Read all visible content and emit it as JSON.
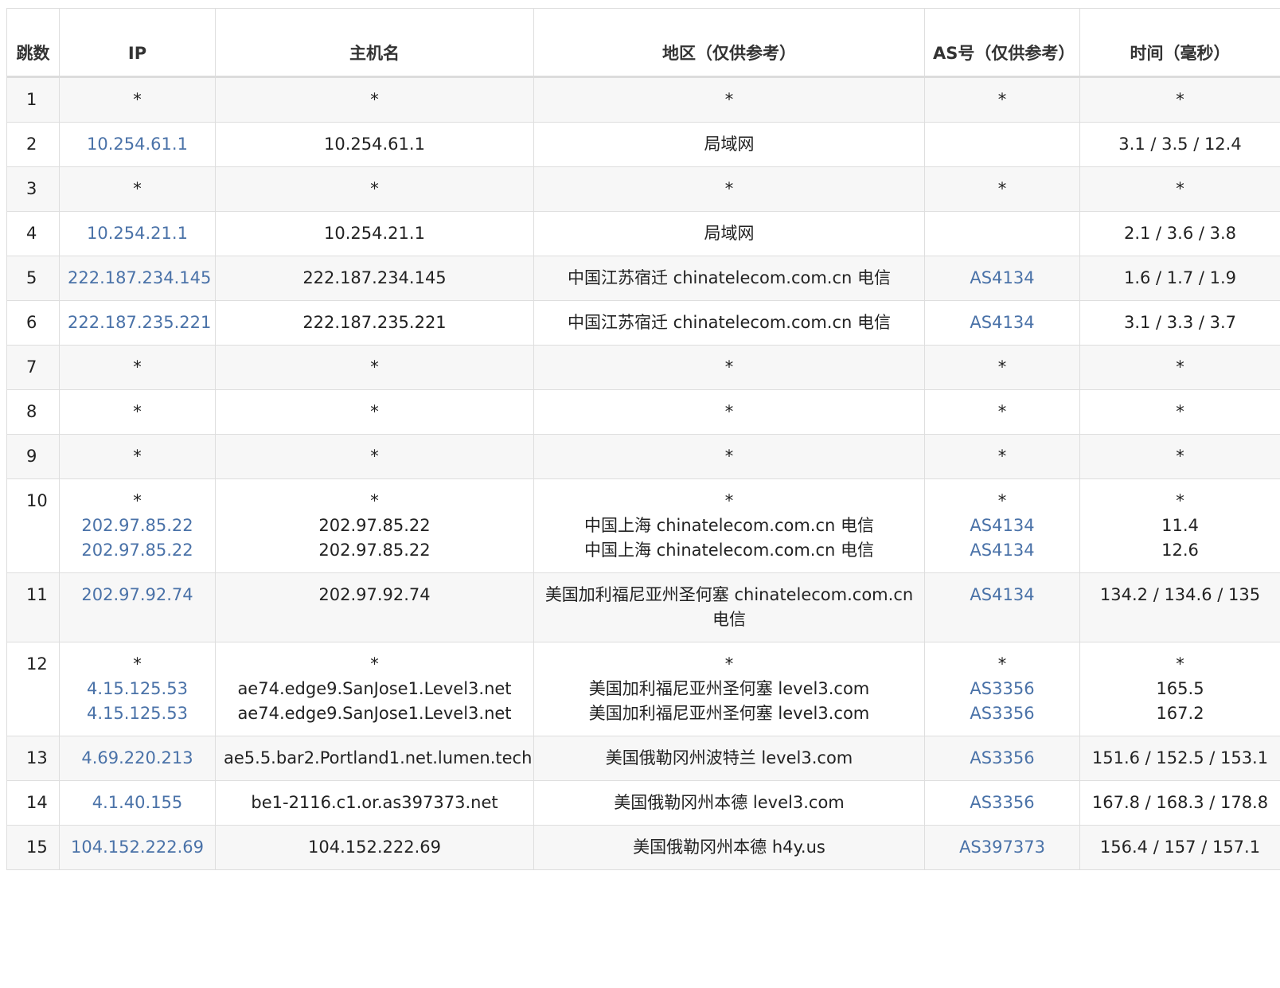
{
  "headers": {
    "hop": "跳数",
    "ip": "IP",
    "host": "主机名",
    "region": "地区（仅供参考）",
    "as": "AS号（仅供参考）",
    "time": "时间（毫秒）"
  },
  "rows": [
    {
      "hop": "1",
      "ip": [
        "*"
      ],
      "host": [
        "*"
      ],
      "region": [
        "*"
      ],
      "as": [
        "*"
      ],
      "time": [
        "*"
      ]
    },
    {
      "hop": "2",
      "ip": [
        "10.254.61.1"
      ],
      "host": [
        "10.254.61.1"
      ],
      "region": [
        "局域网"
      ],
      "as": [
        ""
      ],
      "time": [
        "3.1 / 3.5 / 12.4"
      ]
    },
    {
      "hop": "3",
      "ip": [
        "*"
      ],
      "host": [
        "*"
      ],
      "region": [
        "*"
      ],
      "as": [
        "*"
      ],
      "time": [
        "*"
      ]
    },
    {
      "hop": "4",
      "ip": [
        "10.254.21.1"
      ],
      "host": [
        "10.254.21.1"
      ],
      "region": [
        "局域网"
      ],
      "as": [
        ""
      ],
      "time": [
        "2.1 / 3.6 / 3.8"
      ]
    },
    {
      "hop": "5",
      "ip": [
        "222.187.234.145"
      ],
      "host": [
        "222.187.234.145"
      ],
      "region": [
        "中国江苏宿迁 chinatelecom.com.cn 电信"
      ],
      "as": [
        "AS4134"
      ],
      "time": [
        "1.6 / 1.7 / 1.9"
      ]
    },
    {
      "hop": "6",
      "ip": [
        "222.187.235.221"
      ],
      "host": [
        "222.187.235.221"
      ],
      "region": [
        "中国江苏宿迁 chinatelecom.com.cn 电信"
      ],
      "as": [
        "AS4134"
      ],
      "time": [
        "3.1 / 3.3 / 3.7"
      ]
    },
    {
      "hop": "7",
      "ip": [
        "*"
      ],
      "host": [
        "*"
      ],
      "region": [
        "*"
      ],
      "as": [
        "*"
      ],
      "time": [
        "*"
      ]
    },
    {
      "hop": "8",
      "ip": [
        "*"
      ],
      "host": [
        "*"
      ],
      "region": [
        "*"
      ],
      "as": [
        "*"
      ],
      "time": [
        "*"
      ]
    },
    {
      "hop": "9",
      "ip": [
        "*"
      ],
      "host": [
        "*"
      ],
      "region": [
        "*"
      ],
      "as": [
        "*"
      ],
      "time": [
        "*"
      ]
    },
    {
      "hop": "10",
      "ip": [
        "*",
        "202.97.85.22",
        "202.97.85.22"
      ],
      "host": [
        "*",
        "202.97.85.22",
        "202.97.85.22"
      ],
      "region": [
        "*",
        "中国上海 chinatelecom.com.cn 电信",
        "中国上海 chinatelecom.com.cn 电信"
      ],
      "as": [
        "*",
        "AS4134",
        "AS4134"
      ],
      "time": [
        "*",
        "11.4",
        "12.6"
      ]
    },
    {
      "hop": "11",
      "ip": [
        "202.97.92.74"
      ],
      "host": [
        "202.97.92.74"
      ],
      "region": [
        "美国加利福尼亚州圣何塞 chinatelecom.com.cn 电信"
      ],
      "as": [
        "AS4134"
      ],
      "time": [
        "134.2 / 134.6 / 135"
      ]
    },
    {
      "hop": "12",
      "ip": [
        "*",
        "4.15.125.53",
        "4.15.125.53"
      ],
      "host": [
        "*",
        "ae74.edge9.SanJose1.Level3.net",
        "ae74.edge9.SanJose1.Level3.net"
      ],
      "region": [
        "*",
        "美国加利福尼亚州圣何塞 level3.com",
        "美国加利福尼亚州圣何塞 level3.com"
      ],
      "as": [
        "*",
        "AS3356",
        "AS3356"
      ],
      "time": [
        "*",
        "165.5",
        "167.2"
      ]
    },
    {
      "hop": "13",
      "ip": [
        "4.69.220.213"
      ],
      "host": [
        "ae5.5.bar2.Portland1.net.lumen.tech"
      ],
      "region": [
        "美国俄勒冈州波特兰 level3.com"
      ],
      "as": [
        "AS3356"
      ],
      "time": [
        "151.6 / 152.5 / 153.1"
      ]
    },
    {
      "hop": "14",
      "ip": [
        "4.1.40.155"
      ],
      "host": [
        "be1-2116.c1.or.as397373.net"
      ],
      "region": [
        "美国俄勒冈州本德 level3.com"
      ],
      "as": [
        "AS3356"
      ],
      "time": [
        "167.8 / 168.3 / 178.8"
      ]
    },
    {
      "hop": "15",
      "ip": [
        "104.152.222.69"
      ],
      "host": [
        "104.152.222.69"
      ],
      "region": [
        "美国俄勒冈州本德 h4y.us"
      ],
      "as": [
        "AS397373"
      ],
      "time": [
        "156.4 / 157 / 157.1"
      ]
    }
  ],
  "colors": {
    "link": "#4a72a8",
    "row_alt": "#f7f7f7",
    "border": "#dedede"
  }
}
